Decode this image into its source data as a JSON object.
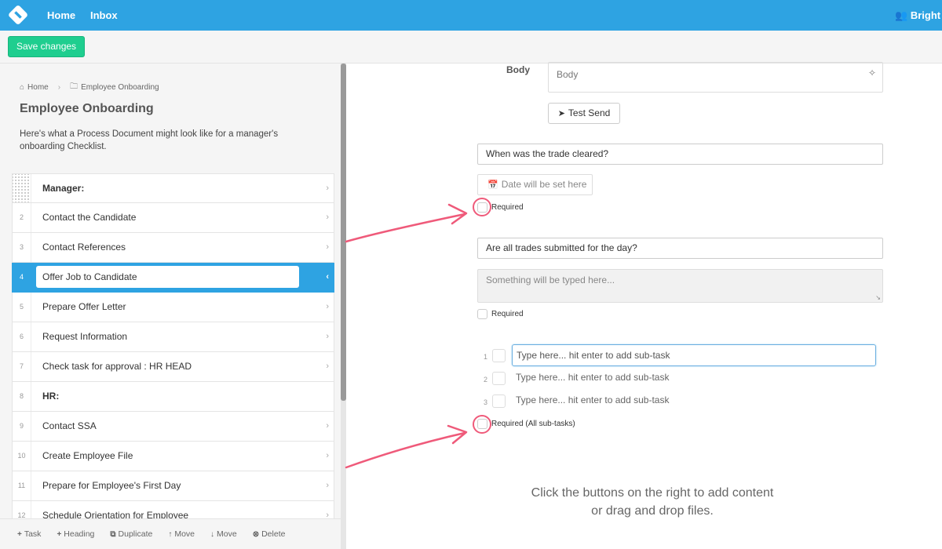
{
  "nav": {
    "logo_icon": "logo-icon",
    "home": "Home",
    "inbox": "Inbox",
    "user": "Bright St",
    "user_icon": "users-icon"
  },
  "toolbar": {
    "save_label": "Save changes"
  },
  "sidebar": {
    "breadcrumb": [
      "Home",
      "Employee Onboarding"
    ],
    "title": "Employee Onboarding",
    "description": "Here's what a Process Document might look like for a manager's onboarding Checklist.",
    "tasks": [
      {
        "num": "",
        "label": "Manager:",
        "heading": true
      },
      {
        "num": "2",
        "label": "Contact the Candidate"
      },
      {
        "num": "3",
        "label": "Contact References"
      },
      {
        "num": "4",
        "label": "Offer Job to Candidate",
        "active": true
      },
      {
        "num": "5",
        "label": "Prepare Offer Letter"
      },
      {
        "num": "6",
        "label": "Request Information"
      },
      {
        "num": "7",
        "label": "Check task for approval : HR HEAD"
      },
      {
        "num": "8",
        "label": "HR:",
        "heading": true
      },
      {
        "num": "9",
        "label": "Contact SSA"
      },
      {
        "num": "10",
        "label": "Create Employee File"
      },
      {
        "num": "11",
        "label": "Prepare for Employee's First Day"
      },
      {
        "num": "12",
        "label": "Schedule Orientation for Employee"
      }
    ],
    "bottom_actions": [
      "Task",
      "Heading",
      "Duplicate",
      "Move",
      "Move",
      "Delete"
    ]
  },
  "editor": {
    "body_label": "Body",
    "body_placeholder": "Body",
    "test_send": "Test Send",
    "question1": "When was the trade cleared?",
    "date_placeholder": "Date will be set here",
    "required": "Required",
    "question2": "Are all trades submitted for the day?",
    "text_placeholder": "Something will be typed here...",
    "subtasks": [
      {
        "num": "1",
        "placeholder": "Type here... hit enter to add sub-task"
      },
      {
        "num": "2",
        "placeholder": "Type here... hit enter to add sub-task"
      },
      {
        "num": "3",
        "placeholder": "Type here... hit enter to add sub-task"
      }
    ],
    "required_all": "Required (All sub-tasks)",
    "hint_line1": "Click the buttons on the right to add content",
    "hint_line2": "or drag and drop files."
  },
  "colors": {
    "nav_blue": "#2ea3e2",
    "save_green": "#1fce8f",
    "annotation_pink": "#ef5a7a"
  }
}
